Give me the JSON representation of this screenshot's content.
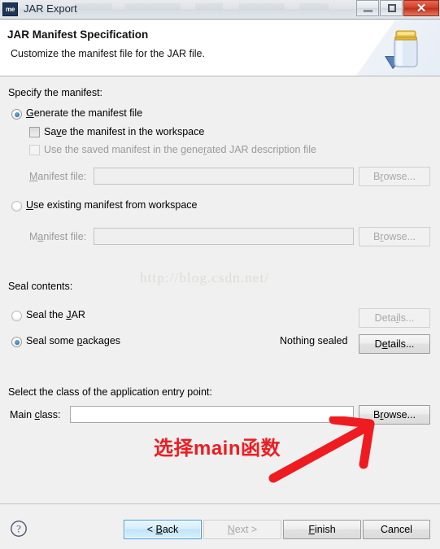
{
  "window": {
    "title": "JAR Export",
    "app_icon": "jar-export-app-icon",
    "app_icon_text": "me",
    "controls": {
      "minimize": "minimize-button",
      "maximize": "maximize-button",
      "close": "close-button",
      "close_glyph": "✕"
    }
  },
  "header": {
    "title": "JAR Manifest Specification",
    "description": "Customize the manifest file for the JAR file.",
    "icon": "jar-jar-icon"
  },
  "manifest_section": {
    "group_label": "Specify the manifest:",
    "generate_radio": {
      "label_pre": "",
      "mnemonic": "G",
      "label_post": "enerate the manifest file",
      "selected": true
    },
    "save_checkbox": {
      "label_pre": "Sa",
      "mnemonic": "v",
      "label_post": "e the manifest in the workspace",
      "checked": false,
      "enabled": true
    },
    "use_saved_checkbox": {
      "label_pre": "Use the saved manifest in the gene",
      "mnemonic": "r",
      "label_post": "ated JAR description file",
      "checked": false,
      "enabled": false
    },
    "manifest_file_label_1": {
      "label_pre": "",
      "mnemonic": "M",
      "label_post": "anifest file:"
    },
    "manifest_file_value_1": "",
    "browse_button_1": {
      "label_pre": "B",
      "mnemonic": "r",
      "label_post": "owse...",
      "enabled": false
    },
    "use_existing_radio": {
      "label_pre": "",
      "mnemonic": "U",
      "label_post": "se existing manifest from workspace",
      "selected": false
    },
    "manifest_file_label_2": {
      "label_pre": "M",
      "mnemonic": "a",
      "label_post": "nifest file:"
    },
    "manifest_file_value_2": "",
    "browse_button_2": {
      "label_pre": "B",
      "mnemonic": "r",
      "label_post": "owse...",
      "enabled": false
    }
  },
  "seal_section": {
    "group_label": "Seal contents:",
    "seal_jar_radio": {
      "label_pre": "Seal the ",
      "mnemonic": "J",
      "label_post": "AR",
      "selected": false
    },
    "seal_jar_details_button": {
      "label_pre": "Deta",
      "mnemonic": "i",
      "label_post": "ls...",
      "enabled": false
    },
    "seal_packages_radio": {
      "label_pre": "Seal some ",
      "mnemonic": "p",
      "label_post": "ackages",
      "selected": true
    },
    "seal_status": "Nothing sealed",
    "seal_packages_details_button": {
      "label_pre": "D",
      "mnemonic": "e",
      "label_post": "tails...",
      "enabled": true
    }
  },
  "entry_point_section": {
    "group_label": "Select the class of the application entry point:",
    "main_class_label": {
      "label_pre": "Main ",
      "mnemonic": "c",
      "label_post": "lass:"
    },
    "main_class_value": "",
    "main_class_placeholder": "",
    "browse_button": {
      "label_pre": "B",
      "mnemonic": "r",
      "label_post": "owse...",
      "enabled": true
    }
  },
  "annotation": {
    "text": "选择main函数",
    "color": "#ee1c21",
    "arrow": "red-arrow-annotation"
  },
  "watermark": {
    "text": "http://blog.csdn.net/"
  },
  "footer": {
    "help_icon": "help-icon",
    "buttons": {
      "back": {
        "label_pre": "< ",
        "mnemonic": "B",
        "label_post": "ack",
        "enabled": true,
        "focused": true
      },
      "next": {
        "label_pre": "",
        "mnemonic": "N",
        "label_post": "ext >",
        "enabled": false
      },
      "finish": {
        "label_pre": "",
        "mnemonic": "F",
        "label_post": "inish",
        "enabled": true
      },
      "cancel": {
        "label_pre": "Cancel",
        "mnemonic": "",
        "label_post": "",
        "enabled": true
      }
    }
  },
  "colors": {
    "accent": "#3c9adf",
    "annotation": "#ee1c21",
    "close_button": "#d4402a",
    "dialog_bg": "#f0f0f0",
    "header_bg": "#ffffff"
  }
}
